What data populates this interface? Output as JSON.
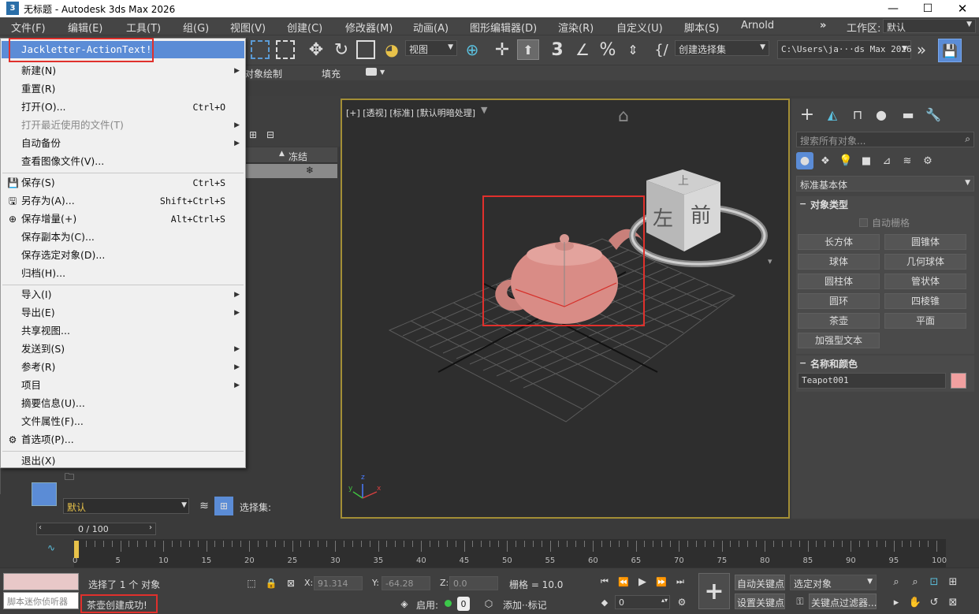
{
  "window": {
    "title": "无标题 - Autodesk 3ds Max 2026",
    "app_icon": "3"
  },
  "menubar": {
    "items": [
      "文件(F)",
      "编辑(E)",
      "工具(T)",
      "组(G)",
      "视图(V)",
      "创建(C)",
      "修改器(M)",
      "动画(A)",
      "图形编辑器(D)",
      "渲染(R)",
      "自定义(U)",
      "脚本(S)",
      "Arnold"
    ],
    "workspace_label": "工作区:",
    "workspace_value": "默认"
  },
  "toolbar": {
    "view_dropdown": "视图",
    "selection_set": "创建选择集",
    "path": "C:\\Users\\ja···ds Max 2026"
  },
  "ribbon": {
    "object_paint": "对象绘制",
    "fill": "填充"
  },
  "file_menu": {
    "items": [
      {
        "label": "Jackletter-ActionText!",
        "shortcut": "",
        "arrow": false,
        "icon": "",
        "disabled": false,
        "highlight": true
      },
      {
        "label": "新建(N)",
        "shortcut": "",
        "arrow": true,
        "icon": "",
        "disabled": false
      },
      {
        "label": "重置(R)",
        "shortcut": "",
        "arrow": false,
        "icon": "",
        "disabled": false
      },
      {
        "label": "打开(O)...",
        "shortcut": "Ctrl+O",
        "arrow": false,
        "icon": "",
        "disabled": false
      },
      {
        "label": "打开最近使用的文件(T)",
        "shortcut": "",
        "arrow": true,
        "icon": "",
        "disabled": true
      },
      {
        "label": "自动备份",
        "shortcut": "",
        "arrow": true,
        "icon": "",
        "disabled": false
      },
      {
        "label": "查看图像文件(V)...",
        "shortcut": "",
        "arrow": false,
        "icon": "",
        "disabled": false
      },
      {
        "label": "保存(S)",
        "shortcut": "Ctrl+S",
        "arrow": false,
        "icon": "save-icon",
        "disabled": false
      },
      {
        "label": "另存为(A)...",
        "shortcut": "Shift+Ctrl+S",
        "arrow": false,
        "icon": "save-as-icon",
        "disabled": false
      },
      {
        "label": "保存增量(+)",
        "shortcut": "Alt+Ctrl+S",
        "arrow": false,
        "icon": "save-increment-icon",
        "disabled": false
      },
      {
        "label": "保存副本为(C)...",
        "shortcut": "",
        "arrow": false,
        "icon": "",
        "disabled": false
      },
      {
        "label": "保存选定对象(D)...",
        "shortcut": "",
        "arrow": false,
        "icon": "",
        "disabled": false
      },
      {
        "label": "归档(H)...",
        "shortcut": "",
        "arrow": false,
        "icon": "",
        "disabled": false
      },
      {
        "label": "导入(I)",
        "shortcut": "",
        "arrow": true,
        "icon": "",
        "disabled": false
      },
      {
        "label": "导出(E)",
        "shortcut": "",
        "arrow": true,
        "icon": "",
        "disabled": false
      },
      {
        "label": "共享视图...",
        "shortcut": "",
        "arrow": false,
        "icon": "",
        "disabled": false
      },
      {
        "label": "发送到(S)",
        "shortcut": "",
        "arrow": true,
        "icon": "",
        "disabled": false
      },
      {
        "label": "参考(R)",
        "shortcut": "",
        "arrow": true,
        "icon": "",
        "disabled": false
      },
      {
        "label": "项目",
        "shortcut": "",
        "arrow": true,
        "icon": "",
        "disabled": false
      },
      {
        "label": "摘要信息(U)...",
        "shortcut": "",
        "arrow": false,
        "icon": "",
        "disabled": false
      },
      {
        "label": "文件属性(F)...",
        "shortcut": "",
        "arrow": false,
        "icon": "",
        "disabled": false
      },
      {
        "label": "首选项(P)...",
        "shortcut": "",
        "arrow": false,
        "icon": "gear-icon",
        "disabled": false
      },
      {
        "label": "退出(X)",
        "shortcut": "",
        "arrow": false,
        "icon": "",
        "disabled": false
      }
    ]
  },
  "scene_explorer": {
    "freeze_header": "冻结",
    "freeze_icon": "❄",
    "layer_value": "默认",
    "selection_set_label": "选择集:"
  },
  "viewport": {
    "label": "[+] [透视] [标准] [默认明暗处理]",
    "viewcube": {
      "top": "上",
      "left": "左",
      "front": "前"
    },
    "axis": {
      "x": "x",
      "y": "y",
      "z": "z"
    }
  },
  "command_panel": {
    "search_placeholder": "搜索所有对象...",
    "category": "标准基本体",
    "object_type_title": "对象类型",
    "auto_grid": "自动栅格",
    "buttons": [
      "长方体",
      "圆锥体",
      "球体",
      "几何球体",
      "圆柱体",
      "管状体",
      "圆环",
      "四棱锥",
      "茶壶",
      "平面",
      "加强型文本"
    ],
    "name_color_title": "名称和颜色",
    "object_name": "Teapot001",
    "object_color": "#f0a0a0"
  },
  "timeline": {
    "frame_display": "0 / 100",
    "ticks": [
      0,
      5,
      10,
      15,
      20,
      25,
      30,
      35,
      40,
      45,
      50,
      55,
      60,
      65,
      70,
      75,
      80,
      85,
      90,
      95,
      100
    ]
  },
  "status": {
    "script_placeholder": "脚本迷你侦听器",
    "selected_text": "选择了 1 个 对象",
    "prompt_text": "茶壶创建成功!",
    "x_label": "X:",
    "x_value": "91.314",
    "y_label": "Y:",
    "y_value": "-64.28",
    "z_label": "Z:",
    "z_value": "0.0",
    "grid_text": "栅格 = 10.0",
    "auto_key": "自动关键点",
    "set_key": "设置关键点",
    "selected_objects": "选定对象",
    "key_filters": "关键点过滤器...",
    "enable_label": "启用:",
    "add_tag": "添加··标记",
    "frame_value": "0"
  },
  "colors": {
    "accent": "#5b8cd6",
    "highlight_box": "#e0302c",
    "viewport_border": "#a38e35",
    "teapot": "#d98c86"
  }
}
